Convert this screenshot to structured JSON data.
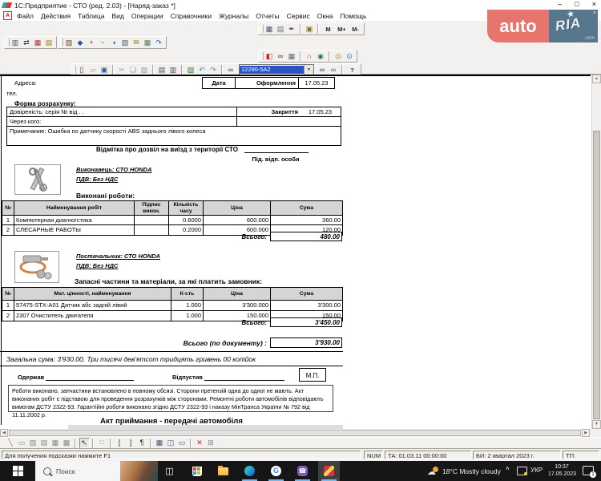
{
  "window": {
    "title": "1С:Предприятие - СТО (ред. 2.03) - [Наряд-заказ *]"
  },
  "glyphs": {
    "min": "–",
    "restore": "□",
    "close": "×",
    "up": "▲",
    "down": "▼",
    "left": "◀",
    "right": "▶",
    "combo_arrow": "▼",
    "chevron": "^",
    "wm_close": "×",
    "star": "★",
    "doc_icon_letter": "А",
    "taskview": "◫",
    "google_letter": "G",
    "phone": "☎",
    "cloud": "☁"
  },
  "watermark": {
    "auto": "auto",
    "ria": "RIA",
    "com": ".com"
  },
  "menu": {
    "items": [
      "Файл",
      "Действия",
      "Таблица",
      "Вид",
      "Операции",
      "Справочники",
      "Журналы",
      "Отчеты",
      "Сервис",
      "Окна",
      "Помощь"
    ]
  },
  "toolbars": {
    "combo_value": "12290-5A2",
    "row1_right": [
      {
        "name": "table-format-icon",
        "glyph": "▦",
        "color": "#44506e"
      },
      {
        "name": "page-setup-icon",
        "glyph": "▤",
        "color": "#6a6a6a"
      },
      {
        "name": "stamp-icon",
        "glyph": "✒",
        "color": "#6a3a3a"
      },
      {
        "sep": true
      },
      {
        "name": "book-icon",
        "glyph": "▣",
        "color": "#8a6a33"
      },
      {
        "sep": true
      },
      {
        "name": "memory-m-button",
        "glyph": "М",
        "wide": true
      },
      {
        "name": "memory-m-plus-button",
        "glyph": "М+",
        "wide": true
      },
      {
        "name": "memory-m-minus-button",
        "glyph": "М-",
        "wide": true
      }
    ],
    "row2_group1": [
      {
        "name": "report-icon",
        "glyph": "▥",
        "color": "#44506e"
      },
      {
        "name": "refresh-icon",
        "glyph": "⇄",
        "color": "#333333"
      },
      {
        "name": "constants-icon",
        "glyph": "▦",
        "color": "#a23333"
      },
      {
        "name": "journal-icon",
        "glyph": "▤",
        "color": "#a07a00"
      }
    ],
    "row2_group2": [
      {
        "name": "catalog-icon",
        "glyph": "▨",
        "color": "#6a4a22"
      },
      {
        "name": "print-form-icon",
        "glyph": "◆",
        "color": "#2a55a0"
      },
      {
        "name": "add-row-icon",
        "glyph": "+",
        "color": "#555555"
      },
      {
        "name": "remove-row-icon",
        "glyph": "−",
        "color": "#555555"
      },
      {
        "name": "page-refresh-icon",
        "glyph": "◑",
        "color": "#2a66a0"
      },
      {
        "name": "page-find-icon",
        "glyph": "▧",
        "color": "#445577"
      },
      {
        "name": "mail-icon",
        "glyph": "✉",
        "color": "#997700"
      },
      {
        "name": "table-marks-icon",
        "glyph": "▦",
        "color": "#557755"
      },
      {
        "name": "update-icon",
        "glyph": "↷",
        "color": "#2255cc"
      }
    ],
    "row3_right": [
      {
        "name": "exit-icon",
        "glyph": "◧",
        "color": "#cc2222"
      },
      {
        "name": "help-search-icon",
        "glyph": "∞",
        "color": "#333333"
      },
      {
        "name": "table-icon",
        "glyph": "▦",
        "color": "#556677"
      },
      {
        "sep": true
      },
      {
        "name": "rainbow-icon",
        "glyph": "∩",
        "color": "#cc3333"
      },
      {
        "name": "globe-icon",
        "glyph": "◉",
        "color": "#227744"
      },
      {
        "sep": true
      },
      {
        "name": "money-icon",
        "glyph": "◎",
        "color": "#aa8800"
      },
      {
        "name": "zoom-icon",
        "glyph": "⊙",
        "color": "#336699"
      }
    ],
    "standard_left": [
      {
        "name": "new-doc-icon",
        "glyph": "▯",
        "color": "#444444"
      },
      {
        "name": "open-icon",
        "glyph": "▱",
        "color": "#c09000"
      },
      {
        "name": "save-icon",
        "glyph": "▣",
        "color": "#235a9a"
      },
      {
        "sep": true
      },
      {
        "name": "cut-icon",
        "glyph": "✂",
        "color": "#9a9a9a"
      },
      {
        "name": "copy-icon",
        "glyph": "❏",
        "color": "#9a9a9a"
      },
      {
        "name": "paste-icon",
        "glyph": "▨",
        "color": "#9a9a9a"
      },
      {
        "sep": true
      },
      {
        "name": "print-icon",
        "glyph": "▤",
        "color": "#444c5a"
      },
      {
        "name": "print-preview-icon",
        "glyph": "▥",
        "color": "#444c5a"
      },
      {
        "sep": true
      },
      {
        "name": "properties-icon",
        "glyph": "▧",
        "color": "#2a7a2a"
      },
      {
        "name": "undo-icon",
        "glyph": "↶",
        "color": "#22a0a0"
      },
      {
        "name": "redo-icon",
        "glyph": "↷",
        "color": "#22a0a0"
      },
      {
        "sep": true
      },
      {
        "name": "find-icon",
        "glyph": "∞",
        "color": "#333333"
      }
    ],
    "standard_right": [
      {
        "name": "find-next-icon",
        "glyph": "∞",
        "color": "#333333"
      },
      {
        "name": "find-prev-icon",
        "glyph": "∞",
        "color": "#555555"
      },
      {
        "sep": true
      },
      {
        "name": "help-icon",
        "glyph": "?",
        "color": "#333333",
        "wide": true
      }
    ],
    "drawing": [
      {
        "name": "line-tool-icon",
        "glyph": "╲",
        "color": "#888888"
      },
      {
        "name": "rect-tool-icon",
        "glyph": "▭",
        "color": "#888888"
      },
      {
        "name": "picture-tool-icon",
        "glyph": "▨",
        "color": "#888888"
      },
      {
        "name": "text-tool-icon",
        "glyph": "▤",
        "color": "#888888"
      },
      {
        "name": "chart-tool-icon",
        "glyph": "▦",
        "color": "#888888"
      },
      {
        "name": "ole-tool-icon",
        "glyph": "▩",
        "color": "#888888"
      },
      {
        "sep": true
      },
      {
        "name": "select-tool-icon",
        "glyph": "↖",
        "color": "#222222",
        "pressed": true
      },
      {
        "sep": true
      },
      {
        "name": "grid-tool-icon",
        "glyph": "∷",
        "color": "#555555"
      },
      {
        "sep": true
      },
      {
        "name": "bracket-open-icon",
        "glyph": "[",
        "color": "#333333"
      },
      {
        "name": "bracket-close-icon",
        "glyph": "]",
        "color": "#333333"
      },
      {
        "name": "section-icon",
        "glyph": "¶",
        "color": "#333333"
      },
      {
        "sep": true
      },
      {
        "name": "table-view-icon",
        "glyph": "▦",
        "color": "#445577"
      },
      {
        "name": "headers-view-icon",
        "glyph": "◫",
        "color": "#445577"
      },
      {
        "name": "panel-view-icon",
        "glyph": "▭",
        "color": "#445577"
      },
      {
        "sep": true
      },
      {
        "name": "block-names-icon",
        "glyph": "✕",
        "color": "#cc2222"
      },
      {
        "name": "layers-icon",
        "glyph": "⊞",
        "color": "#889"
      }
    ]
  },
  "doc": {
    "address_label": "Адреса:",
    "phone_label": "тел.",
    "date_label": "Дата",
    "issued_label": "Оформлення",
    "issued_value": "17.05.23",
    "payment_form_label": "Форма розрахунку:",
    "proxy_line": "Довіреність: серія    №    від    .   .",
    "closing_label": "Закриття",
    "closing_value": "17.05.23",
    "through_whom": "Через кого:",
    "note": "Примечание: Ошибка по датчику скорості ABS заднього лівого колеса",
    "exit_permit": "Відмітка про дозвіл на виїзд з території СТО",
    "signature_label": "Під. відп. особи",
    "works": {
      "performer": "Виконавець:   СТО   HONDA",
      "vat": "ПДВ: Без НДС",
      "section_title": "Виконані роботи:",
      "headers": [
        "№",
        "Найменування робіт",
        "Підпис викон.",
        "Кількість часу",
        "Ціна",
        "Сума"
      ],
      "rows": [
        {
          "num": "1",
          "name": "Компютерная диагногстика",
          "qty": "0.6000",
          "price": "600.000",
          "sum": "360.00"
        },
        {
          "num": "2",
          "name": "СЛЕСАРНЫЕ РАБОТЫ",
          "qty": "0.2000",
          "price": "600.000",
          "sum": "120.00"
        }
      ],
      "total_label": "Всього:",
      "total": "480.00"
    },
    "parts": {
      "supplier": "Постачальник:   СТО   HONDA",
      "vat": "ПДВ: Без НДС",
      "section_title": "Запасні частини та матеріали, за які платить замовник:",
      "headers": [
        "№",
        "Мат. цінності, найменування",
        "К-сть",
        "Ціна",
        "Сума"
      ],
      "rows": [
        {
          "num": "1",
          "name": "57475-STX-A01 Датчик абс задній лівий",
          "qty": "1.000",
          "price": "3'300.000",
          "sum": "3'300.00"
        },
        {
          "num": "2",
          "name": "2307 Очиститель двигателя",
          "qty": "1.000",
          "price": "150.000",
          "sum": "150.00"
        }
      ],
      "total_label": "Всього:",
      "total": "3'450.00"
    },
    "grand_total_label": "Всього (по документу) :",
    "grand_total": "3'930.00",
    "total_in_words": "Загальна сума:  3'930.00, Три тисячі дев'ятсот тридцять гривень 00 копійок",
    "received_label": "Одержав",
    "released_label": "Відпустив",
    "stamp_label": "М.П.",
    "disclaimer": "Роботи виконано, запчастини встановлено в повному обсязі. Сторони претензій одна до одної не мають. Акт виконаних робіт є підставою для проведення розрахунків між сторонами. Ремонтні роботи автомобілів відповідають вимогам ДСТУ 2322-93. Гарантійні роботи виконано згідно ДСТУ 2322-93 і наказу МінТранса України № 792 від 11.11.2002 р.",
    "act_title": "Акт приймання - передачі автомобіля"
  },
  "statusbar": {
    "hint": "Для получения подсказки нажмите F1",
    "num": "NUM",
    "ta": "ТА: 01.03.11  00:00:00",
    "bi": "БИ: 2 квартал 2023 г.",
    "tp": "ТП:"
  },
  "taskbar": {
    "search_placeholder": "Поиск",
    "weather": "18°C  Mostly cloudy",
    "lang": "УКР",
    "time": "10:37",
    "date": "17.05.2023",
    "notification_count": "1"
  }
}
